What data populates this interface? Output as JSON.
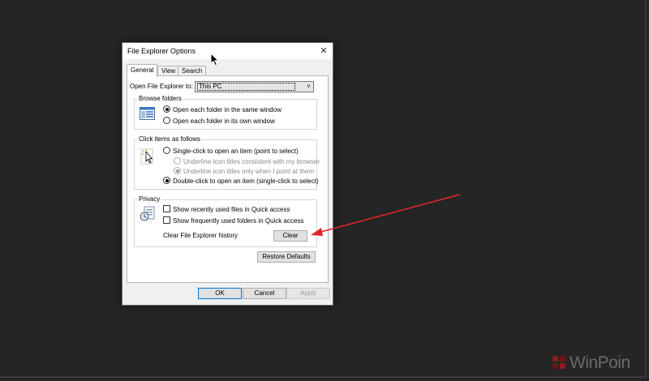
{
  "dialog": {
    "title": "File Explorer Options",
    "close_glyph": "✕",
    "tabs": [
      {
        "label": "General",
        "active": true
      },
      {
        "label": "View",
        "active": false
      },
      {
        "label": "Search",
        "active": false
      }
    ],
    "open_explorer": {
      "label": "Open File Explorer to:",
      "selected": "This PC",
      "arrow_glyph": "∨"
    },
    "browse_folders": {
      "label": "Browse folders",
      "options": [
        {
          "label": "Open each folder in the same window",
          "checked": true
        },
        {
          "label": "Open each folder in its own window",
          "checked": false
        }
      ]
    },
    "click_items": {
      "label": "Click items as follows",
      "single": "Single-click to open an item (point to select)",
      "underline_browser": "Underline icon titles consistent with my browser",
      "underline_point": "Underline icon titles only when I point at them",
      "double": "Double-click to open an item (single-click to select)"
    },
    "privacy": {
      "label": "Privacy",
      "recent_files": "Show recently used files in Quick access",
      "frequent_folders": "Show frequently used folders in Quick access",
      "clear_label": "Clear File Explorer history",
      "clear_button": "Clear"
    },
    "restore_button": "Restore Defaults",
    "ok_button": "OK",
    "cancel_button": "Cancel",
    "apply_button": "Apply"
  },
  "watermark": {
    "text": "WinPoin"
  },
  "colors": {
    "background": "#252525",
    "arrow": "#e0262a",
    "focus_border": "#0078d7"
  }
}
